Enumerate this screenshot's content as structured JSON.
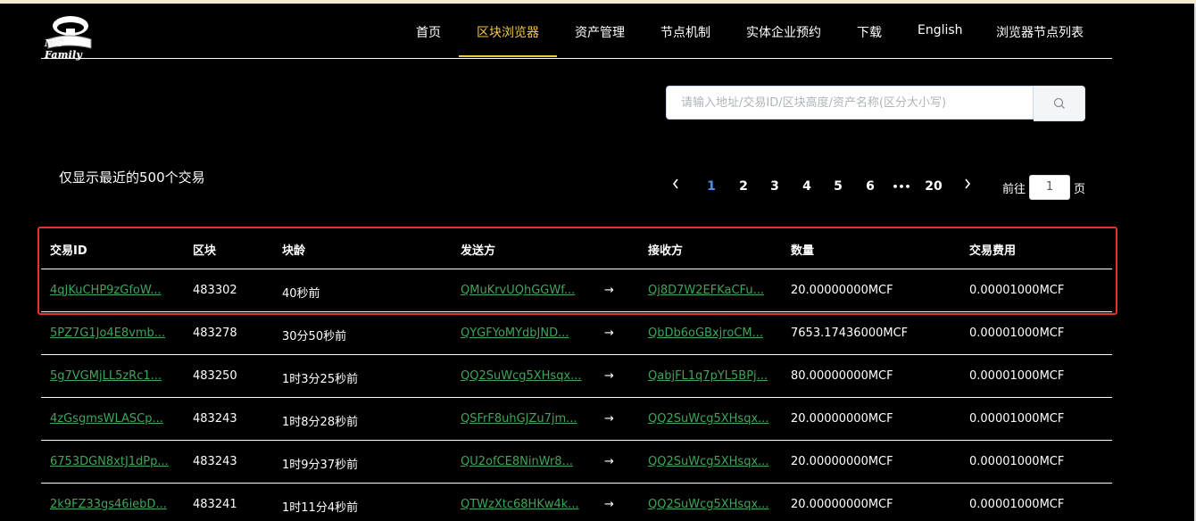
{
  "logo": {
    "text": "MC Family"
  },
  "nav": {
    "items": [
      "首页",
      "区块浏览器",
      "资产管理",
      "节点机制",
      "实体企业预约",
      "下载",
      "English",
      "浏览器节点列表"
    ],
    "active_index": 1
  },
  "search": {
    "placeholder": "请输入地址/交易ID/区块高度/资产名称(区分大小写)"
  },
  "notice": "仅显示最近的500个交易",
  "pagination": {
    "pages": [
      "1",
      "2",
      "3",
      "4",
      "5",
      "6",
      "•••",
      "20"
    ],
    "current": "1",
    "goto_prefix": "前往",
    "goto_value": "1",
    "goto_suffix": "页"
  },
  "table": {
    "headers": [
      "交易ID",
      "区块",
      "块龄",
      "发送方",
      "接收方",
      "数量",
      "交易费用"
    ],
    "rows": [
      {
        "id": "4qJKuCHP9zGfoW...",
        "block": "483302",
        "age": "40秒前",
        "from": "QMuKrvUQhGGWf...",
        "to": "Qj8D7W2EFKaCFu...",
        "amount": "20.00000000MCF",
        "fee": "0.00001000MCF"
      },
      {
        "id": "5PZ7G1Jo4E8vmb...",
        "block": "483278",
        "age": "30分50秒前",
        "from": "QYGFYoMYdbJND...",
        "to": "QbDb6oGBxjroCM...",
        "amount": "7653.17436000MCF",
        "fee": "0.00001000MCF"
      },
      {
        "id": "5g7VGMjLL5zRc1...",
        "block": "483250",
        "age": "1时3分25秒前",
        "from": "QQ2SuWcg5XHsqx...",
        "to": "QabjFL1q7pYL5BPj...",
        "amount": "80.00000000MCF",
        "fee": "0.00001000MCF"
      },
      {
        "id": "4zGsgmsWLASCp...",
        "block": "483243",
        "age": "1时8分28秒前",
        "from": "QSFrF8uhGJZu7jm...",
        "to": "QQ2SuWcg5XHsqx...",
        "amount": "20.00000000MCF",
        "fee": "0.00001000MCF"
      },
      {
        "id": "6753DGN8xtJ1dPp...",
        "block": "483243",
        "age": "1时9分37秒前",
        "from": "QU2ofCE8NinWr8...",
        "to": "QQ2SuWcg5XHsqx...",
        "amount": "20.00000000MCF",
        "fee": "0.00001000MCF"
      },
      {
        "id": "2k9FZ33gs46iebD...",
        "block": "483241",
        "age": "1时11分4秒前",
        "from": "QTWzXtc68HKw4k...",
        "to": "QQ2SuWcg5XHsqx...",
        "amount": "20.00000000MCF",
        "fee": "0.00001000MCF"
      }
    ]
  },
  "icons": {
    "search": "search-icon",
    "prev": "chevron-left-icon",
    "next": "chevron-right-icon",
    "transfer": "arrow-right-icon"
  },
  "colors": {
    "accent": "#f5c44a",
    "link": "#3fa55a",
    "page_active": "#4f8df5",
    "highlight": "#e5322d"
  }
}
